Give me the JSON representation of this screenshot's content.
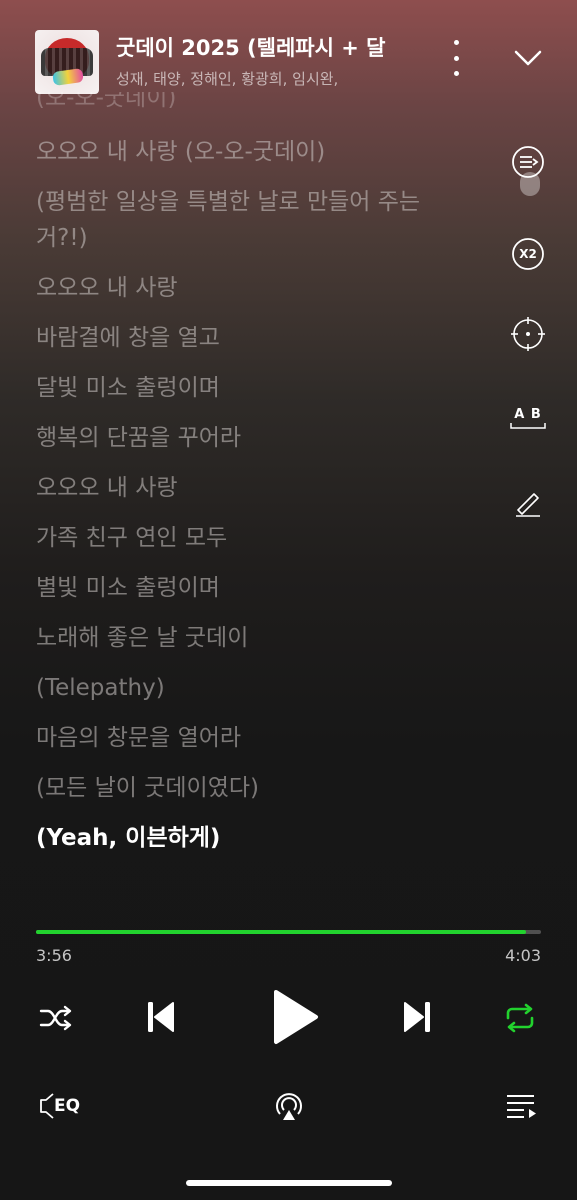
{
  "header": {
    "song_title": "굿데이 2025 (텔레파시 + 달",
    "artists": "성재, 태양, 정해인, 황광희, 임시완,"
  },
  "lyrics": {
    "partial_top": "(오-오-굿데이)",
    "lines": [
      "오오오 내 사랑 (오-오-굿데이)",
      "(평범한 일상을 특별한 날로 만들어 주는",
      "거?!)",
      "오오오 내 사랑",
      "바람결에 창을 열고",
      "달빛 미소 출렁이며",
      "행복의 단꿈을 꾸어라",
      "오오오 내 사랑",
      "가족 친구 연인 모두",
      "별빛 미소 출렁이며",
      "노래해 좋은 날 굿데이",
      "(Telepathy)",
      "마음의 창문을 열어라",
      "(모든 날이 굿데이였다)",
      "(Yeah, 이븐하게)"
    ],
    "active_index": 14
  },
  "side_tools": {
    "speed_label": "X2",
    "translate_label": "A B"
  },
  "player": {
    "current_time": "3:56",
    "total_time": "4:03",
    "progress": 0.971,
    "accent_color": "#22d22e"
  },
  "bottom_bar": {
    "eq_label": "EQ"
  }
}
